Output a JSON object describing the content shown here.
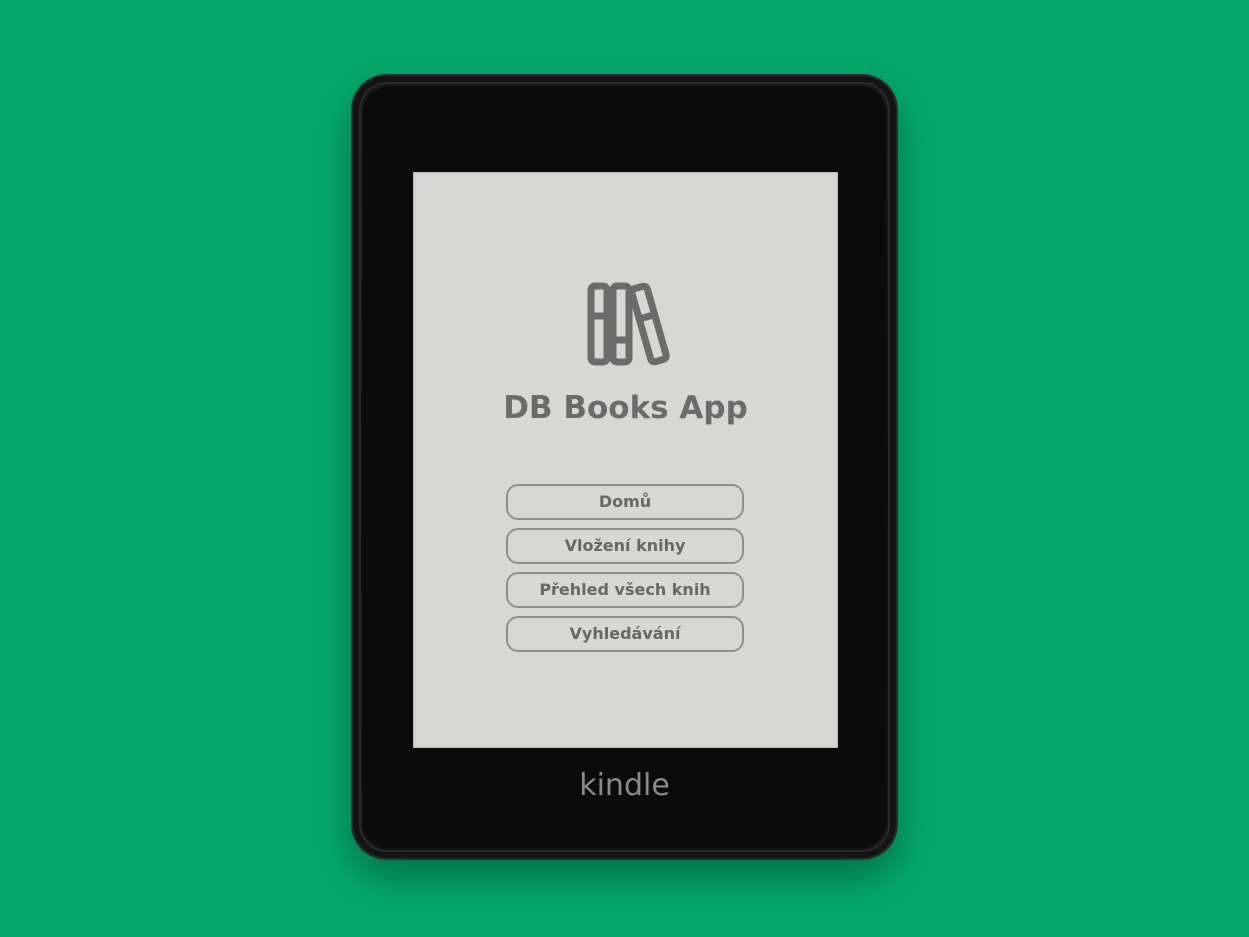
{
  "app": {
    "title": "DB Books App",
    "logo_icon": "books-icon"
  },
  "nav": {
    "items": [
      {
        "label": "Domů"
      },
      {
        "label": "Vložení knihy"
      },
      {
        "label": "Přehled všech knih"
      },
      {
        "label": "Vyhledávání"
      }
    ]
  },
  "device": {
    "brand": "kindle"
  },
  "colors": {
    "background": "#05a86a",
    "screen": "#d7d7d4",
    "text": "#6b6b6b",
    "button_border": "#8f8f8f",
    "device": "#0c0c0c"
  }
}
